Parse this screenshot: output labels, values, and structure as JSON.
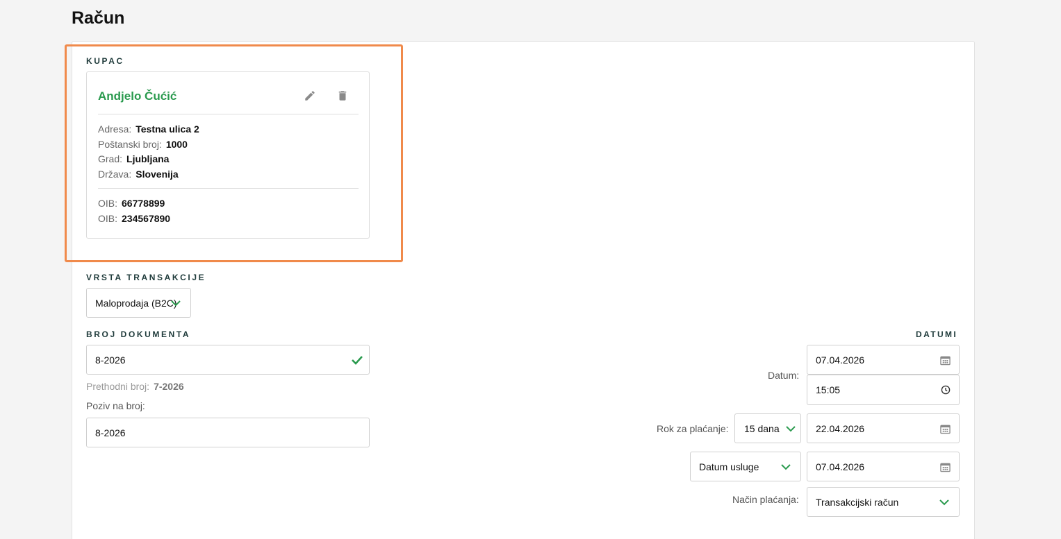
{
  "page": {
    "title": "Račun"
  },
  "customer": {
    "section_label": "KUPAC",
    "name": "Andjelo Čućić",
    "edit_icon": "pencil-icon",
    "delete_icon": "trash-icon",
    "address": [
      {
        "key": "Adresa:",
        "value": "Testna ulica 2"
      },
      {
        "key": "Poštanski broj:",
        "value": "1000"
      },
      {
        "key": "Grad:",
        "value": "Ljubljana"
      },
      {
        "key": "Država:",
        "value": "Slovenija"
      }
    ],
    "ids": [
      {
        "key": "OIB:",
        "value": "66778899"
      },
      {
        "key": "OIB:",
        "value": "234567890"
      }
    ]
  },
  "transaction": {
    "section_label": "VRSTA TRANSAKCIJE",
    "selected": "Maloprodaja (B2C)"
  },
  "document": {
    "section_label": "BROJ DOKUMENTA",
    "number": "8-2026",
    "previous_label": "Prethodni broj:",
    "previous_value": "7-2026",
    "reference_label": "Poziv na broj:",
    "reference_value": "8-2026"
  },
  "dates": {
    "section_label": "DATUMI",
    "date_label": "Datum:",
    "date_value": "07.04.2026",
    "time_value": "15:05",
    "due_label": "Rok za plaćanje:",
    "due_term": "15 dana",
    "due_date": "22.04.2026",
    "service_select": "Datum usluge",
    "service_date": "07.04.2026",
    "payment_label": "Način plaćanja:",
    "payment_method": "Transakcijski račun"
  },
  "colors": {
    "accent_green": "#2a9a4e",
    "highlight_orange": "#f08a4b"
  }
}
